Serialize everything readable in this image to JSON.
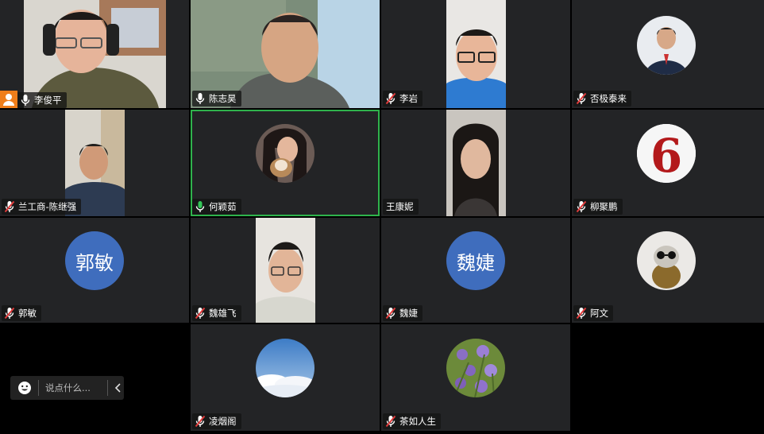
{
  "participants": [
    {
      "name": "李俊平"
    },
    {
      "name": "陈志昊"
    },
    {
      "name": "李岩"
    },
    {
      "name": "否极泰来"
    },
    {
      "name": "兰工商-陈继强"
    },
    {
      "name": "何颖茹"
    },
    {
      "name": "王康妮"
    },
    {
      "name": "柳聚鹏"
    },
    {
      "name": "郭敏",
      "initials": "郭敏"
    },
    {
      "name": "魏雄飞"
    },
    {
      "name": "魏婕",
      "initials": "魏婕"
    },
    {
      "name": "阿文"
    },
    {
      "name": "凌烟阁"
    },
    {
      "name": "茶如人生"
    }
  ],
  "chat": {
    "placeholder": "说点什么..."
  },
  "colors": {
    "tile": "#232426",
    "active": "#2fb34c",
    "muted": "#e23b3b",
    "avatar_text_bg": "#3f6dbd",
    "host": "#ef7e1b"
  },
  "icons": [
    "mic-icon",
    "mic-muted-icon",
    "host-icon",
    "emoji-icon",
    "chevron-left-icon"
  ]
}
